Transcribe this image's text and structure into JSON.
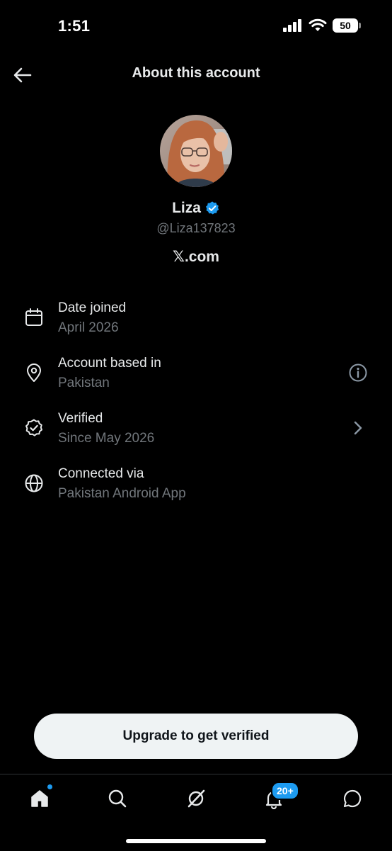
{
  "status_bar": {
    "time": "1:51",
    "battery": "50"
  },
  "header": {
    "title": "About this account",
    "back_icon": "arrow-left-icon"
  },
  "profile": {
    "name": "Liza",
    "handle": "@Liza137823",
    "site": "𝕏.com",
    "verified_badge_color": "#1d9bf0"
  },
  "info": [
    {
      "title": "Date joined",
      "subtitle": "April 2026",
      "icon": "calendar-icon"
    },
    {
      "title": "Account based in",
      "subtitle": "Pakistan",
      "icon": "location-pin-icon",
      "trailing": "info-icon"
    },
    {
      "title": "Verified",
      "subtitle": "Since May 2026",
      "icon": "verified-badge-icon",
      "trailing": "chevron-right-icon"
    },
    {
      "title": "Connected via",
      "subtitle": "Pakistan Android App",
      "icon": "globe-icon"
    }
  ],
  "upgrade": {
    "label": "Upgrade to get verified"
  },
  "tab_bar": {
    "tabs": [
      "home-icon",
      "search-icon",
      "grok-icon",
      "bell-icon",
      "messages-icon"
    ],
    "notification_badge": "20+"
  },
  "colors": {
    "background": "#000000",
    "primary_text": "#e7e9ea",
    "secondary_text": "#71767b",
    "accent": "#1d9bf0",
    "button_bg": "#eff3f4"
  }
}
